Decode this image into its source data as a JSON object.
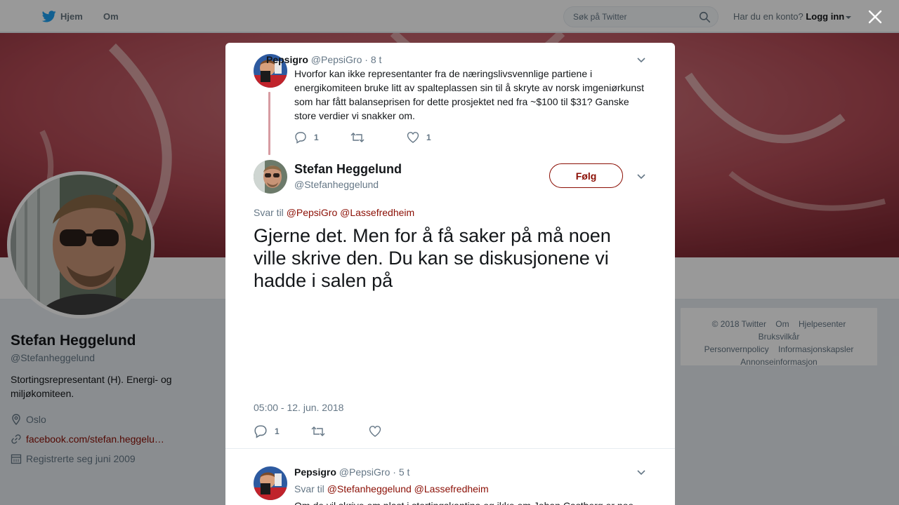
{
  "topbar": {
    "home_label": "Hjem",
    "about_label": "Om",
    "search_placeholder": "Søk på Twitter",
    "account_prompt": "Har du en konto?",
    "login_label": "Logg inn"
  },
  "profile": {
    "name": "Stefan Heggelund",
    "handle": "@Stefanheggelund",
    "bio": "Stortingsrepresentant (H). Energi- og miljøkomiteen.",
    "location": "Oslo",
    "url": "facebook.com/stefan.heggelu…",
    "joined": "Registrerte seg juni 2009"
  },
  "footer": {
    "links": [
      "© 2018 Twitter",
      "Om",
      "Hjelpesenter",
      "Bruksvilkår",
      "Personvernpolicy",
      "Informasjonskapsler",
      "Annonseinformasjon"
    ]
  },
  "parent_tweet": {
    "name": "Pepsigro",
    "handle": "@PepsiGro",
    "time": "· 8 t",
    "text": "Hvorfor kan ikke representanter fra de næringslivsvennlige partiene i energikomiteen bruke litt av spalteplassen sin til å skryte av norsk imgeniørkunst som har fått balanseprisen for dette prosjektet ned fra ~$100 til $31? Ganske store verdier vi snakker om.",
    "replies": "1",
    "retweets": "",
    "likes": "1"
  },
  "main_tweet": {
    "name": "Stefan Heggelund",
    "handle": "@Stefanheggelund",
    "follow_label": "Følg",
    "reply_prefix": "Svar til",
    "mentions": "@PepsiGro @Lassefredheim",
    "text": "Gjerne det. Men for å få saker på må noen ville skrive den. Du kan se diskusjonene vi hadde i salen på",
    "timestamp": "05:00 - 12. jun. 2018",
    "replies": "1",
    "retweets": "",
    "likes": ""
  },
  "reply_tweet": {
    "name": "Pepsigro",
    "handle": "@PepsiGro",
    "time": "· 5 t",
    "reply_prefix": "Svar til",
    "mentions": "@Stefanheggelund @Lassefredheim",
    "text": "Om de vil skrive om plast i stortingskantina og ikke om Johan Castberg er noe"
  },
  "colors": {
    "accent": "#8b0e04",
    "twitter_blue": "#1da1f2",
    "muted": "#657786"
  },
  "icons": [
    "twitter-bird-icon",
    "search-icon",
    "close-icon",
    "chevron-down-icon",
    "reply-icon",
    "retweet-icon",
    "heart-icon",
    "location-icon",
    "link-icon",
    "calendar-icon"
  ]
}
